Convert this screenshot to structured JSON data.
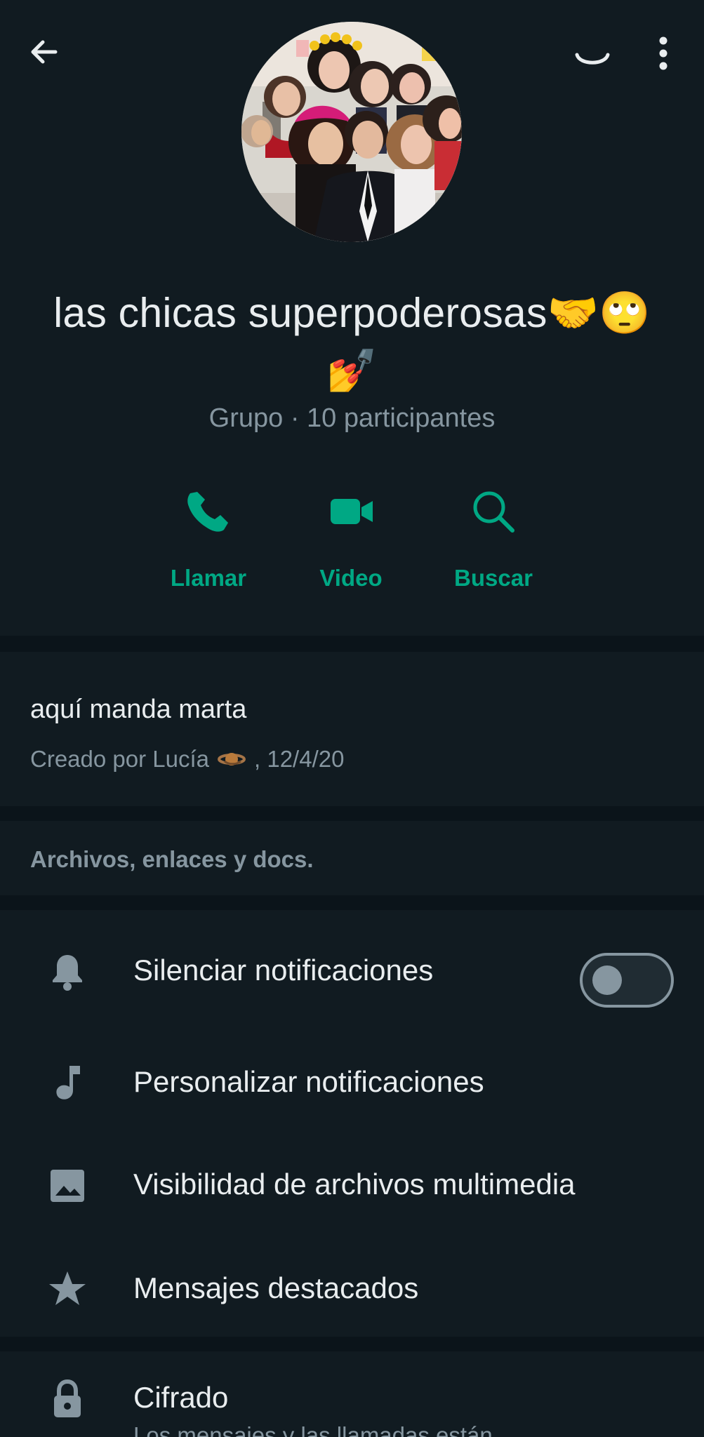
{
  "header": {
    "back_icon": "arrow-left-icon",
    "loading_icon": "loading-spinner-icon",
    "menu_icon": "more-vertical-icon"
  },
  "profile": {
    "avatar_icon": "group-photo",
    "group_name": "las chicas superpoderosas🤝🙄💅",
    "meta": "Grupo · 10 participantes"
  },
  "actions": [
    {
      "label": "Llamar",
      "icon": "phone-icon"
    },
    {
      "label": "Video",
      "icon": "video-icon"
    },
    {
      "label": "Buscar",
      "icon": "search-icon"
    }
  ],
  "description": {
    "text": "aquí manda marta",
    "created_prefix": "Creado por Lucía",
    "created_suffix": ", 12/4/20",
    "emoji_icon": "planet-icon"
  },
  "files": {
    "label": "Archivos, enlaces y docs."
  },
  "settings": {
    "mute": {
      "label": "Silenciar notificaciones",
      "icon": "bell-icon",
      "enabled": false
    },
    "custom": {
      "label": "Personalizar notificaciones",
      "icon": "music-note-icon"
    },
    "media": {
      "label": "Visibilidad de archivos multimedia",
      "icon": "image-icon"
    },
    "starred": {
      "label": "Mensajes destacados",
      "icon": "star-icon"
    }
  },
  "encryption": {
    "title": "Cifrado",
    "subtitle": "Los mensajes y las llamadas están",
    "icon": "lock-icon"
  },
  "colors": {
    "background": "#0b141a",
    "surface": "#111b21",
    "text": "#e9edef",
    "secondary_text": "#8696a0",
    "accent": "#00a884"
  }
}
